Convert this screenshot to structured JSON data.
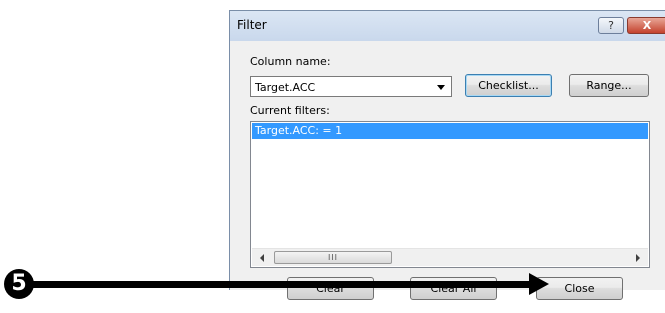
{
  "dialog": {
    "title": "Filter",
    "help_glyph": "?",
    "close_glyph": "X",
    "column_name_label": "Column name:",
    "column_select_value": "Target.ACC",
    "checklist_button": "Checklist...",
    "range_button": "Range...",
    "current_filters_label": "Current filters:",
    "filters": [
      "Target.ACC: = 1"
    ],
    "scroll_thumb_grip": "III",
    "footer_buttons": {
      "clear": "Clear",
      "clear_all": "Clear All",
      "close": "Close"
    }
  },
  "annotation": {
    "step_number": "5"
  },
  "colors": {
    "selection": "#3399ff",
    "title_bar": "#c9d8ec",
    "close_button": "#c4422d"
  },
  "icons": [
    "help-icon",
    "close-icon",
    "dropdown-arrow-icon",
    "scroll-left-icon",
    "scroll-right-icon"
  ]
}
